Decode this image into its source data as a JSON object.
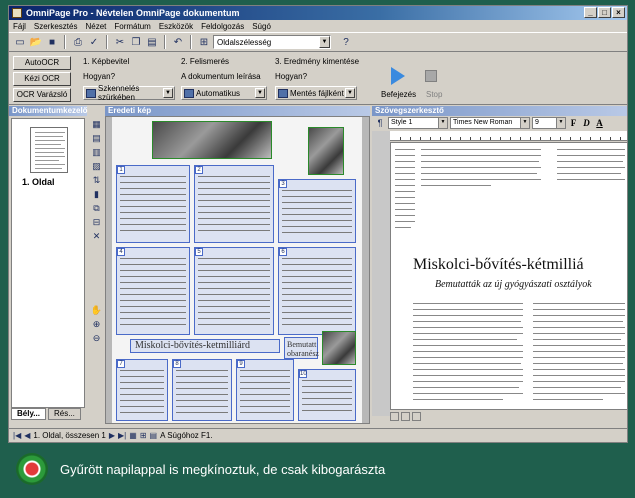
{
  "window": {
    "title": "OmniPage Pro - Névtelen OmniPage dokumentum",
    "controls": [
      "_",
      "□",
      "×"
    ]
  },
  "menu": [
    "Fájl",
    "Szerkesztés",
    "Nézet",
    "Formátum",
    "Eszközök",
    "Feldolgozás",
    "Súgó"
  ],
  "toolbar": {
    "zoom_combo": "Oldalszélesség",
    "icons": [
      "new-icon",
      "open-icon",
      "save-icon",
      "print-icon",
      "spellcheck-icon",
      "cut-icon",
      "copy-icon",
      "paste-icon",
      "undo-icon",
      "zoom-icon",
      "help-pointer-icon"
    ]
  },
  "ocr": {
    "buttons": [
      "AutoOCR",
      "Kézi OCR",
      "OCR Varázsló"
    ],
    "steps": [
      {
        "title": "1. Képbevitel",
        "question": "Hogyan?",
        "value": "Szkennelés szürkében"
      },
      {
        "title": "2. Felismerés",
        "question": "A dokumentum leírása",
        "value": "Automatikus"
      },
      {
        "title": "3. Eredmény kimentése",
        "question": "Hogyan?",
        "value": "Mentés fájlként"
      }
    ],
    "start_label": "Befejezés",
    "stop_label": "Stop"
  },
  "thumbnails": {
    "header": "Dokumentumkezelő",
    "page_label": "1. Oldal",
    "tabs": [
      "Bély...",
      "Rés..."
    ]
  },
  "original": {
    "header": "Eredeti kép",
    "headline": "Miskolci-bővítés-ketmilliárd",
    "small_zone": "Bemutatt obaranész"
  },
  "editor": {
    "header": "Szövegszerkesztő",
    "style": "Style 1",
    "font": "Times New Roman",
    "size": "9",
    "format_buttons": [
      "F",
      "D",
      "A"
    ],
    "headline": "Miskolci-bővítés-kétmilliá",
    "subheadline": "Bemutatták az új gyógyászati osztályok"
  },
  "status": {
    "text": "1. Oldal, összesen 1",
    "help": "A Súgóhoz F1."
  },
  "caption": {
    "text": "Gyűrött napilappal is megkínoztuk, de csak kibogarászta"
  },
  "colors": {
    "title_gradient_start": "#0a246a",
    "frame_green": "#1f5f4d",
    "zone_blue": "#4a6ac8"
  }
}
